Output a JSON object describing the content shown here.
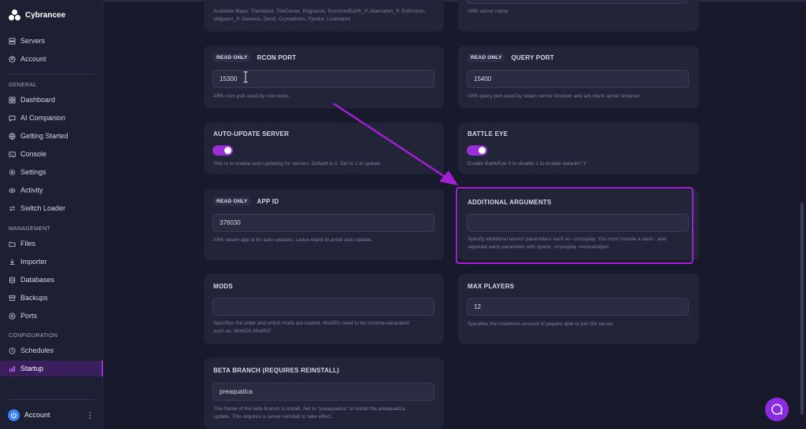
{
  "brand": {
    "name": "Cybrancee"
  },
  "sidebar": {
    "top_items": [
      {
        "label": "Servers",
        "icon": "server-icon"
      },
      {
        "label": "Account",
        "icon": "user-circle-icon"
      }
    ],
    "sections": [
      {
        "label": "GENERAL",
        "items": [
          {
            "label": "Dashboard",
            "icon": "grid-icon"
          },
          {
            "label": "AI Companion",
            "icon": "chat-icon"
          },
          {
            "label": "Getting Started",
            "icon": "globe-icon"
          },
          {
            "label": "Console",
            "icon": "terminal-icon"
          },
          {
            "label": "Settings",
            "icon": "gear-icon"
          },
          {
            "label": "Activity",
            "icon": "eye-icon"
          },
          {
            "label": "Switch Loader",
            "icon": "swap-icon"
          }
        ]
      },
      {
        "label": "MANAGEMENT",
        "items": [
          {
            "label": "Files",
            "icon": "folder-icon"
          },
          {
            "label": "Importer",
            "icon": "download-icon"
          },
          {
            "label": "Databases",
            "icon": "database-icon"
          },
          {
            "label": "Backups",
            "icon": "archive-icon"
          },
          {
            "label": "Ports",
            "icon": "network-icon"
          }
        ]
      },
      {
        "label": "CONFIGURATION",
        "items": [
          {
            "label": "Schedules",
            "icon": "clock-icon"
          },
          {
            "label": "Startup",
            "icon": "startup-icon",
            "active": true
          }
        ]
      }
    ],
    "account_label": "Account",
    "account_menu": "⋮"
  },
  "cards": {
    "maps_hint": "Available Maps: TheIsland, TheCenter, Ragnarok, ScorchedEarth_P, Aberration_P, Extinction, Valguero_P, Genesis, Gen2, CrystalIsles, Fjordur, LostIsland",
    "server_name_hint": "ARK server name",
    "rcon": {
      "badge": "READ ONLY",
      "title": "RCON PORT",
      "value": "15300",
      "hint": "ARK rcon port used by rcon tools."
    },
    "query": {
      "badge": "READ ONLY",
      "title": "QUERY PORT",
      "value": "15400",
      "hint": "ARK query port used by steam server browser and ark client server browser."
    },
    "auto_update": {
      "title": "AUTO-UPDATE SERVER",
      "enabled": true,
      "hint": "This is to enable auto-updating for servers. Default is 0. Set to 1 to update"
    },
    "battle_eye": {
      "title": "BATTLE EYE",
      "enabled": true,
      "hint": "Enable BattleEye 0 to disable 1 to enable default=\"1\""
    },
    "app_id": {
      "badge": "READ ONLY",
      "title": "APP ID",
      "value": "376030",
      "hint": "ARK steam app id for auto updates. Leave blank to avoid auto update."
    },
    "additional_args": {
      "title": "ADDITIONAL ARGUMENTS",
      "value": "",
      "hint1": "Specify additional launch parameters such as -crossplay. You must include a dash - and",
      "hint2": "separate each parameter with space: -crossplay -exclusivejoin"
    },
    "mods": {
      "title": "MODS",
      "value": "",
      "hint1": "Specifies the order and which mods are loaded. ModIDs need to be comma-separated",
      "hint2": "such as: ModID1,ModID2"
    },
    "max_players": {
      "title": "MAX PLAYERS",
      "value": "12",
      "hint": "Specifies the maximum amount of players able to join the server."
    },
    "beta_branch": {
      "title": "BETA BRANCH (REQUIRES REINSTALL)",
      "value": "preaquatica",
      "hint1": "The Name of the beta branch to install. Set to \"preaquatica\" to install the preaquatica",
      "hint2": "update. This requires a server reinstall to take effect."
    }
  },
  "colors": {
    "accent": "#9b30d9",
    "highlight": "#a21fd6",
    "background": "#181a2b",
    "card": "#222438"
  }
}
